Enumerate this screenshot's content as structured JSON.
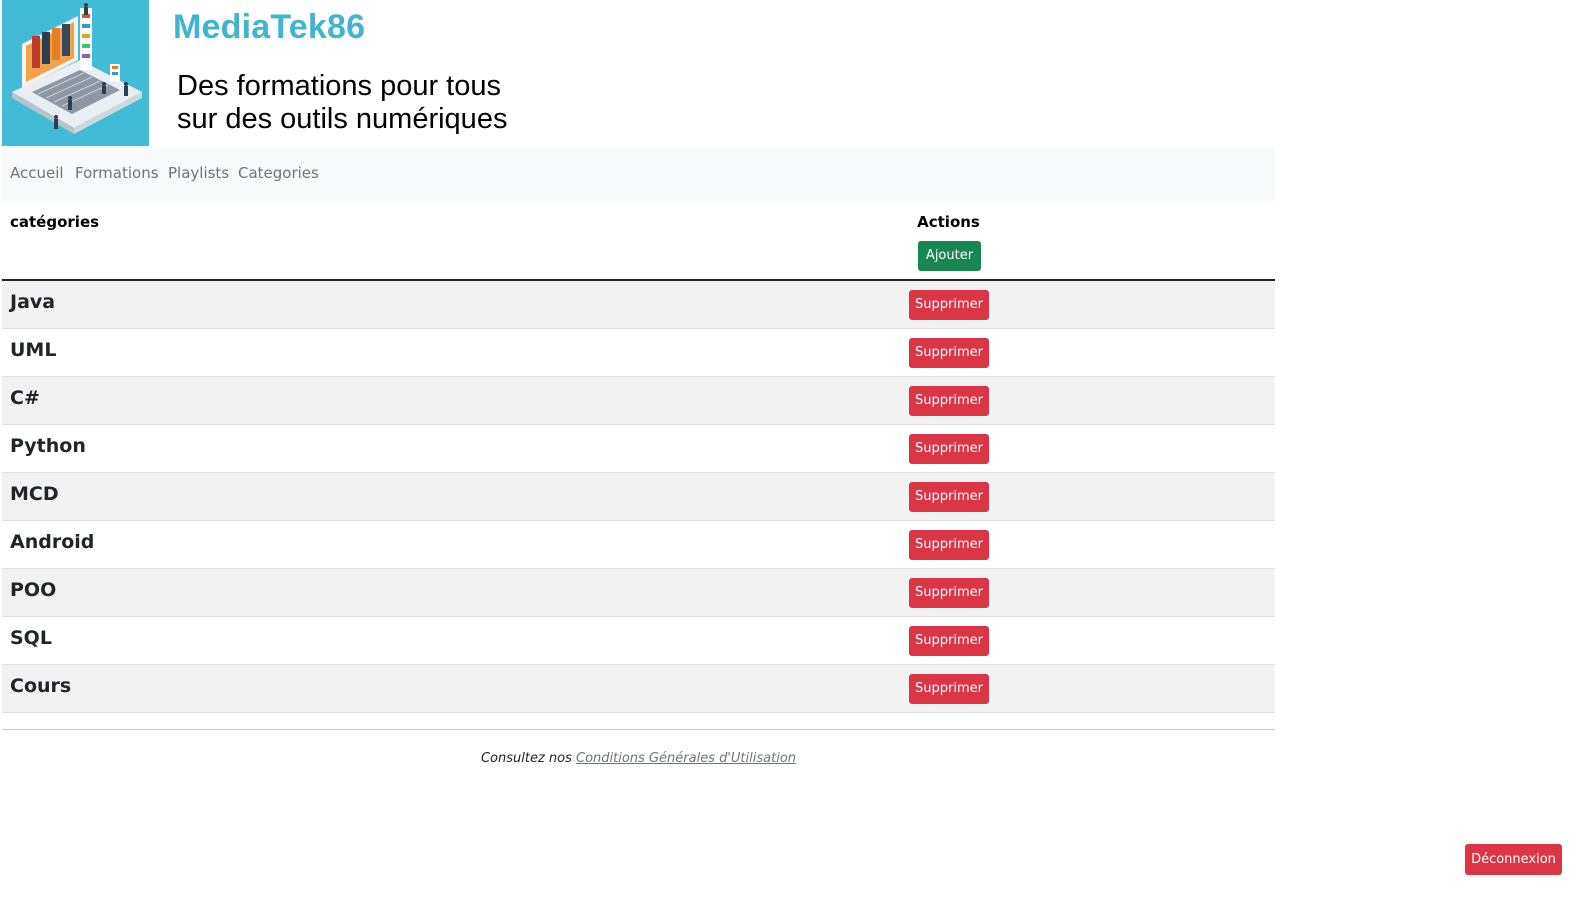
{
  "header": {
    "title": "MediaTek86",
    "tagline_line1": "Des formations pour tous",
    "tagline_line2": "sur des outils numériques"
  },
  "nav": {
    "items": [
      {
        "label": "Accueil"
      },
      {
        "label": "Formations"
      },
      {
        "label": "Playlists"
      },
      {
        "label": "Categories"
      }
    ]
  },
  "table": {
    "col_categories": "catégories",
    "col_actions": "Actions",
    "add_label": "Ajouter",
    "delete_label": "Supprimer",
    "rows": [
      {
        "name": "Java"
      },
      {
        "name": "UML"
      },
      {
        "name": "C#"
      },
      {
        "name": "Python"
      },
      {
        "name": "MCD"
      },
      {
        "name": "Android"
      },
      {
        "name": "POO"
      },
      {
        "name": "SQL"
      },
      {
        "name": "Cours"
      }
    ]
  },
  "footer": {
    "prefix": "Consultez nos ",
    "link": "Conditions Générales d'Utilisation"
  },
  "logout_label": "Déconnexion",
  "colors": {
    "brand": "#41b4d2",
    "success": "#198754",
    "danger": "#dc3545"
  }
}
